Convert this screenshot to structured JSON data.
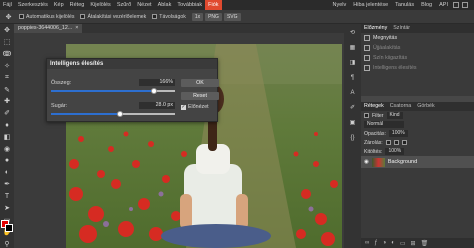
{
  "menubar": {
    "items": [
      "Fájl",
      "Szerkesztés",
      "Kép",
      "Réteg",
      "Kijelölés",
      "Szűrő",
      "Nézet",
      "Ablak",
      "Továbbiak",
      "Fiók"
    ],
    "active_index": 9,
    "right": [
      "Nyelv",
      "Hiba jelentése",
      "Tanulás",
      "Blog",
      "API"
    ]
  },
  "options": {
    "auto_select": "Automatikus kijelölés",
    "transform_controls": "Átalakítási vezérlőelemek",
    "distances": "Távolságok",
    "zoom": "1x",
    "png": "PNG",
    "svg": "SVG"
  },
  "document": {
    "tab_title": "poppies-3644006_12...",
    "close": "×"
  },
  "dialog": {
    "title": "Intelligens élesítés",
    "amount_label": "Összeg:",
    "amount_value": "166%",
    "amount_fraction": 0.83,
    "radius_label": "Sugár:",
    "radius_value": "28.0 px",
    "radius_fraction": 0.56,
    "ok": "OK",
    "reset": "Reset",
    "preview_label": "Előnézet",
    "preview_checked": true
  },
  "history": {
    "tabs": [
      "Előzmény",
      "Színtár"
    ],
    "items": [
      "Megnyitás",
      "Újjáalakítás",
      "Szín kiigazítás",
      "Intelligens élesítés"
    ]
  },
  "layers": {
    "tabs": [
      "Rétegek",
      "Csatorna",
      "Görbék"
    ],
    "filter_label": "Filter",
    "filter_value": "Kind",
    "blend_mode": "Normál",
    "opacity_label": "Opacitás:",
    "opacity_value": "100%",
    "lock_label": "Zárolás:",
    "fill_label": "Kitöltés:",
    "fill_value": "100%",
    "background_layer": "Background"
  },
  "colors": {
    "accent": "#e04a2f",
    "foreground": "#e30000",
    "background": "#000000"
  }
}
